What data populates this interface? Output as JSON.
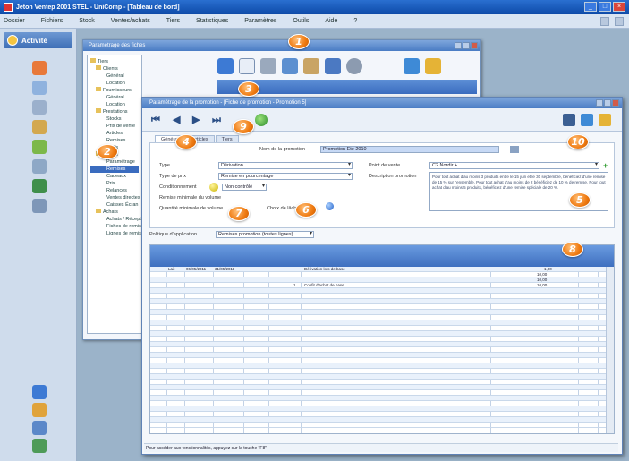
{
  "app": {
    "title": "Jeton Ventep 2001 STEL - UniComp - [Tableau de bord]",
    "menu": [
      "Dossier",
      "Fichiers",
      "Stock",
      "Ventes/achats",
      "Tiers",
      "Statistiques",
      "Paramètres",
      "Outils",
      "Aide",
      "?"
    ]
  },
  "sidebar": {
    "header": "Activité"
  },
  "background_window": {
    "title": "Paramétrage des fiches",
    "tree": [
      "Tiers",
      "Clients",
      "Général",
      "Location",
      "Fournisseurs",
      "Général",
      "Location",
      "Prestations",
      "Stocks",
      "Prix de vente",
      "Articles",
      "Remises",
      "Tarifs",
      "Ventes",
      "Paramétrage",
      "Remises",
      "Cadeaux",
      "Prix",
      "Relances",
      "Ventes directes",
      "Caisses Écran",
      "Achats",
      "Achats / Réception",
      "Fiches de remise",
      "Lignes de remise"
    ]
  },
  "editor": {
    "title": "Paramétrage de la promotion - [Fiche de promotion - Promotion 5]",
    "tabs": [
      "Général",
      "Articles",
      "Tiers"
    ],
    "labels": {
      "name": "Nom de la promotion",
      "type": "Type",
      "price_type": "Type de prix",
      "conditionnement": "Conditionnement",
      "remise": "Remise minimale du volume",
      "quantite": "Quantité minimale de volume",
      "choix": "Choix de lâcher",
      "point": "Point de vente",
      "desc": "Description promotion",
      "poli": "Politique d'application"
    },
    "values": {
      "name": "Promotion Été 2010",
      "type": "Dérivation",
      "price_type": "Remise en pourcentage",
      "conditionnement": "Non contrôlé",
      "point": "C2 Nordir +",
      "desc": "Pour tout achat d'au moins 3 produits entre le 15 juin et le 30 septembre, bénéficiez d'une remise de 15 % sur l'ensemble. Pour tout achat d'au moins de 2 bénéficiez de 10 % de remise. Pour tout achat d'au moins 5 produits, bénéficiez d'une remise spéciale de 20 %.",
      "poli": "Remises promotion (toutes lignes)"
    },
    "grid": {
      "row1": {
        "code": "Lait",
        "date_from": "06/05/2011",
        "date_to": "31/05/2011",
        "designation": "Dérivation lots de base",
        "price": "1,00"
      },
      "row2": {
        "qty": "10,00",
        "total": "10,00"
      },
      "row3": {
        "designation": "Confit d'achat de base",
        "qty": "1",
        "price": "10,00"
      }
    },
    "status": "Pour accéder aux fonctionnalités, appuyez sur la touche \"F8\""
  },
  "callouts": [
    "1",
    "2",
    "3",
    "4",
    "5",
    "6",
    "7",
    "8",
    "9",
    "10"
  ],
  "colors": {
    "callout": "#ef7a10",
    "titlebar": "#0d4aa8",
    "grid_header": "#3e6fbf"
  }
}
